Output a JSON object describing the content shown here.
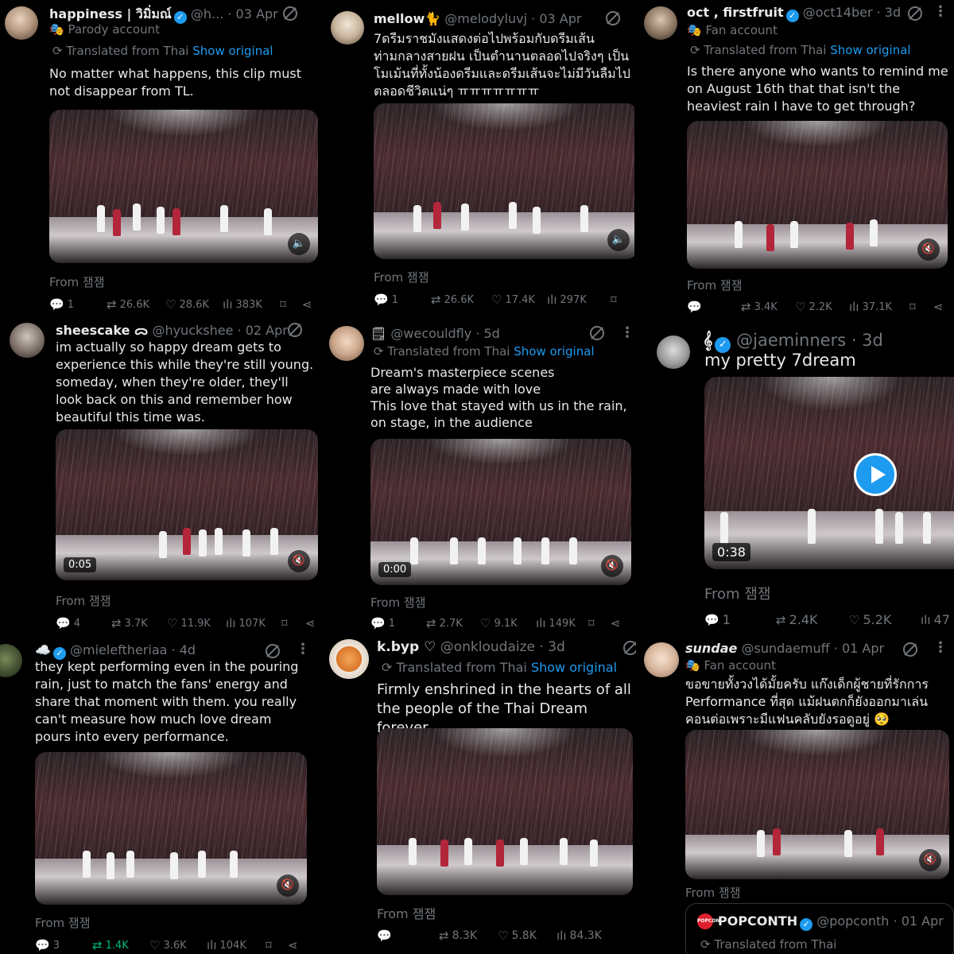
{
  "tweets": [
    {
      "name": "happiness | วิมิ่มณ์",
      "handle": "@h...",
      "date": "· 03 Apr",
      "sub_label": "Parody account",
      "translated": "Translated from Thai",
      "show_original": "Show original",
      "text": "No matter what happens, this clip must not disappear from TL.",
      "from": "From 잼잼",
      "replies": "1",
      "reposts": "26.6K",
      "likes": "28.6K",
      "views": "383K"
    },
    {
      "name": "mellow🐈",
      "handle": "@melodyluvj",
      "date": "· 03 Apr",
      "text": "7ดรีมราชมังแสดงต่อไปพร้อมกับดรีมเส้นท่ามกลางสายฝน เป็นตำนานตลอดไปจริงๆ เป็นโมเม้นที่ทั้งน้องดรีมและดรีมเส้นจะไม่มีวันลืมไปตลอดชีวิตแน่ๆ ㅠㅠㅠㅠㅠㅠㅠ",
      "from": "From 잼잼",
      "replies": "1",
      "reposts": "26.6K",
      "likes": "17.4K",
      "views": "297K"
    },
    {
      "name": "oct , firstfruit",
      "handle": "@oct14ber",
      "date": "· 3d",
      "sub_label": "Fan account",
      "translated": "Translated from Thai",
      "show_original": "Show original",
      "text": "Is there anyone who wants to remind me on August 16th that that isn't the heaviest rain I have to get through?",
      "from": "From 잼잼",
      "replies": "",
      "reposts": "3.4K",
      "likes": "2.2K",
      "views": "37.1K"
    },
    {
      "name": "sheescake ᯅ",
      "handle": "@hyuckshee",
      "date": "· 02 Apr",
      "text": "im actually so happy dream gets to experience this while they're still young. someday, when they're older, they'll look back on this and remember how beautiful this time was.",
      "video_time": "0:05",
      "from": "From 잼잼",
      "replies": "4",
      "reposts": "3.7K",
      "likes": "11.9K",
      "views": "107K"
    },
    {
      "name": "",
      "handle": "@wecouldfly",
      "date": "· 5d",
      "translated": "Translated from Thai",
      "show_original": "Show original",
      "text_lines": [
        "Dream's masterpiece scenes",
        "are always made with love",
        "This love that stayed with us in the rain, on stage, in the audience"
      ],
      "video_time": "0:00",
      "from": "From 잼잼",
      "replies": "1",
      "reposts": "2.7K",
      "likes": "9.1K",
      "views": "149K"
    },
    {
      "name": "",
      "handle": "@jaeminners",
      "date": "· 3d",
      "text": "my pretty 7dream",
      "video_time": "0:38",
      "from": "From 잼잼",
      "replies": "1",
      "reposts": "2.4K",
      "likes": "5.2K",
      "views": "47"
    },
    {
      "name": "",
      "handle": "@mieleftheriaa",
      "date": "· 4d",
      "text": "they kept performing even in the pouring rain, just to match the fans' energy and share that moment with them. you really can't measure how much love dream pours into every performance.",
      "from": "From 잼잼",
      "replies": "3",
      "reposts": "1.4K",
      "likes": "3.6K",
      "views": "104K"
    },
    {
      "name": "k.byp ♡",
      "handle": "@onkloudaize",
      "date": "· 3d",
      "translated": "Translated from Thai",
      "show_original": "Show original",
      "text": "Firmly enshrined in the hearts of all the people of the Thai Dream forever.",
      "from": "From 잼잼",
      "replies": "",
      "reposts": "8.3K",
      "likes": "5.8K",
      "views": "84.3K"
    },
    {
      "name": "sundae",
      "handle": "@sundaemuff",
      "date": "· 01 Apr",
      "sub_label": "Fan account",
      "text": "ขอขายทั้งวงได้มั้ยครับ แก๊งเด็กผู้ชายที่รักการ Performance ที่สุด แม้ฝนตกก็ยังออกมาเล่นคอนต่อเพราะมีแฟนคลับยังรอดูอยู่ 🥺",
      "from": "From 잼잼",
      "quote_name": "POPCONTH",
      "quote_handle": "@popconth",
      "quote_date": "· 01 Apr",
      "quote_translated": "Translated from Thai",
      "quote_logo": "POPCON"
    }
  ],
  "colors": {
    "background": "#000000",
    "text": "#e7e9ea",
    "muted": "#71767b",
    "link": "#1d9bf0",
    "repost_active": "#00ba7c"
  }
}
